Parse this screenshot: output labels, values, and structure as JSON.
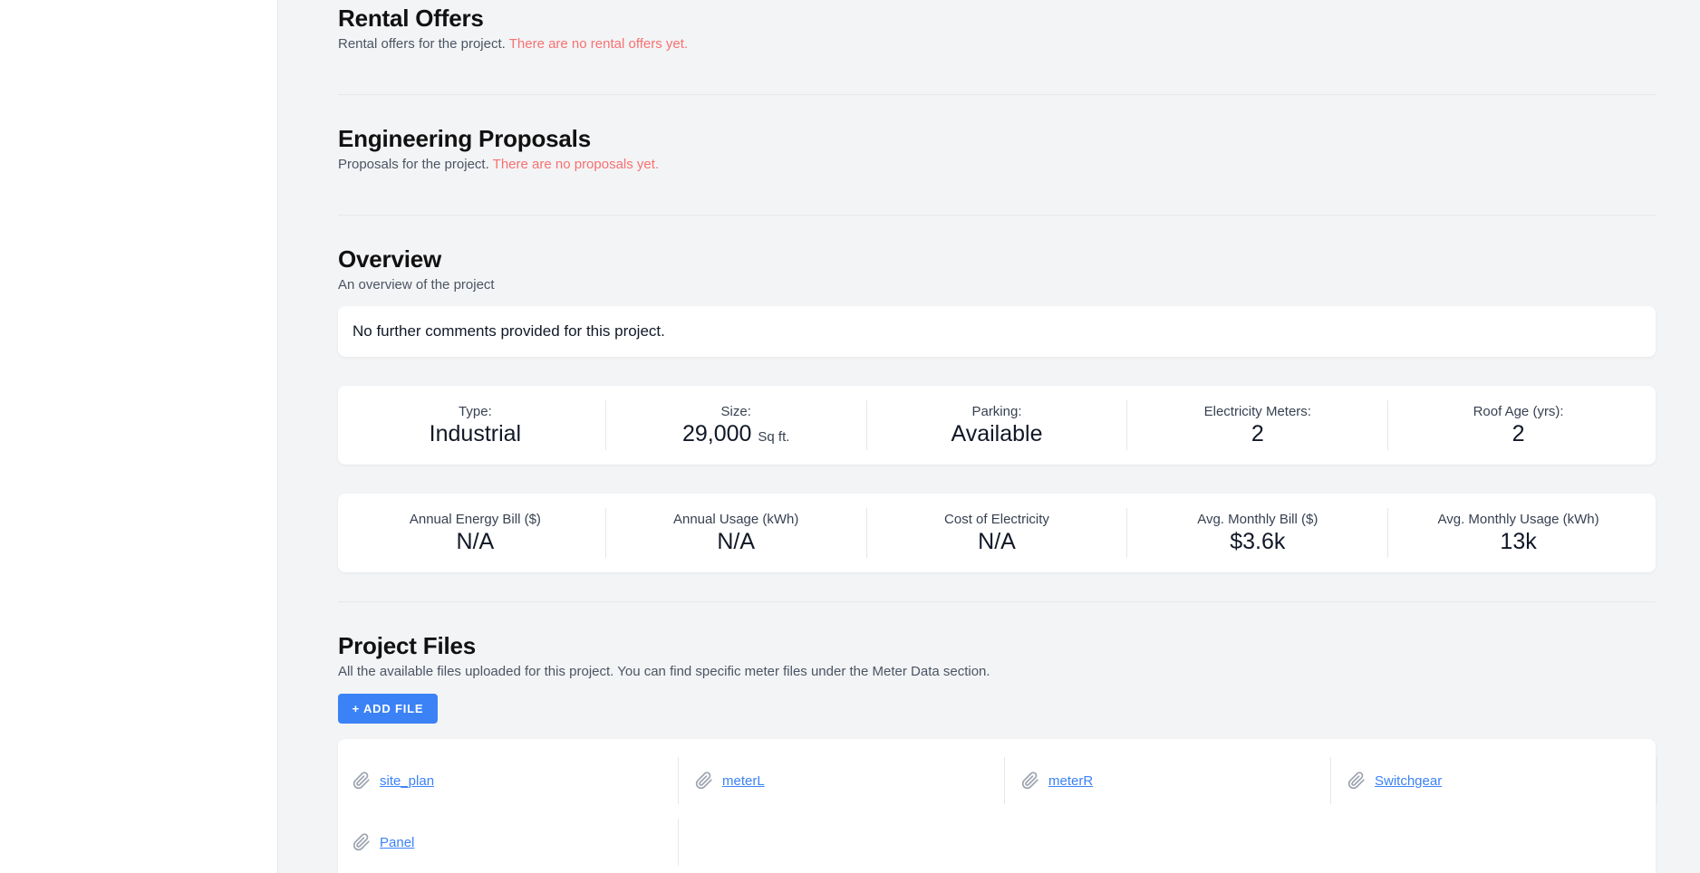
{
  "rental": {
    "title": "Rental Offers",
    "subtitle": "Rental offers for the project.",
    "empty": "There are no rental offers yet."
  },
  "engineering": {
    "title": "Engineering Proposals",
    "subtitle": "Proposals for the project.",
    "empty": "There are no proposals yet."
  },
  "overview": {
    "title": "Overview",
    "subtitle": "An overview of the project",
    "comment": "No further comments provided for this project.",
    "stats": [
      {
        "label": "Type:",
        "value": "Industrial",
        "unit": ""
      },
      {
        "label": "Size:",
        "value": "29,000",
        "unit": "Sq ft."
      },
      {
        "label": "Parking:",
        "value": "Available",
        "unit": ""
      },
      {
        "label": "Electricity Meters:",
        "value": "2",
        "unit": ""
      },
      {
        "label": "Roof Age (yrs):",
        "value": "2",
        "unit": ""
      }
    ],
    "energy": [
      {
        "label": "Annual Energy Bill ($)",
        "value": "N/A"
      },
      {
        "label": "Annual Usage (kWh)",
        "value": "N/A"
      },
      {
        "label": "Cost of Electricity",
        "value": "N/A"
      },
      {
        "label": "Avg. Monthly Bill ($)",
        "value": "$3.6k"
      },
      {
        "label": "Avg. Monthly Usage (kWh)",
        "value": "13k"
      }
    ]
  },
  "files": {
    "title": "Project Files",
    "subtitle": "All the available files uploaded for this project. You can find specific meter files under the Meter Data section.",
    "add_label": "+ ADD FILE",
    "items": [
      {
        "name": "site_plan",
        "icon": "paperclip-icon"
      },
      {
        "name": "meterL",
        "icon": "paperclip-icon"
      },
      {
        "name": "meterR",
        "icon": "paperclip-icon"
      },
      {
        "name": "Switchgear",
        "icon": "paperclip-icon"
      },
      {
        "name": "Panel",
        "icon": "paperclip-icon"
      }
    ]
  },
  "colors": {
    "accent": "#3b82f6",
    "empty_note": "#f87171",
    "background": "#f3f4f6"
  }
}
